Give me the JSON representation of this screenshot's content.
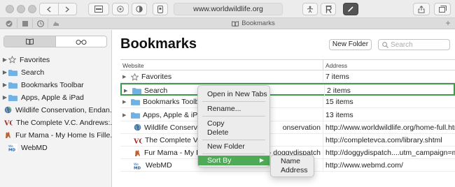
{
  "toolbar": {
    "url": "www.worldwildlife.org",
    "icons": [
      "sidebar-icon",
      "back-icon",
      "forward-icon",
      "share-ext-icon",
      "privacy-icon",
      "reader-icon",
      "extension-icon",
      "translate-icon",
      "r-icon",
      "pen-icon",
      "share-icon",
      "tabs-icon"
    ]
  },
  "tab": {
    "title": "Bookmarks"
  },
  "sidebar": {
    "items": [
      {
        "label": "Favorites",
        "icon": "star-icon"
      },
      {
        "label": "Search",
        "icon": "folder-icon"
      },
      {
        "label": "Bookmarks Toolbar",
        "icon": "folder-icon"
      },
      {
        "label": "Apps, Apple & iPad",
        "icon": "folder-icon"
      },
      {
        "label": "Wildlife Conservation, Endan...",
        "icon": "globe-icon"
      },
      {
        "label": "The Complete V.C. Andrews:...",
        "icon": "vc-icon"
      },
      {
        "label": "Fur Mama - My Home Is Fille...",
        "icon": "dog-icon"
      },
      {
        "label": "WebMD",
        "icon": "webmd-icon"
      }
    ]
  },
  "main": {
    "title": "Bookmarks",
    "new_folder": "New Folder",
    "search_placeholder": "Search",
    "col_website": "Website",
    "col_address": "Address",
    "rows": [
      {
        "name": "Favorites",
        "address": "7 items",
        "icon": "star-icon",
        "folder": true
      },
      {
        "name": "Search",
        "address": "2 items",
        "icon": "folder-icon",
        "folder": true
      },
      {
        "name": "Bookmarks Toolbar",
        "address": "15 items",
        "icon": "folder-icon",
        "folder": true
      },
      {
        "name": "Apps, Apple & iPad",
        "address": "13 items",
        "icon": "folder-icon",
        "folder": true
      },
      {
        "name": "Wildlife Conservation",
        "name_tail": "onservation",
        "address": "http://www.worldwildlife.org/home-full.html",
        "icon": "globe-icon",
        "folder": false
      },
      {
        "name": "The Complete V.C. A",
        "name_tail": "",
        "address": "http://completevca.com/library.shtml",
        "icon": "vc-icon",
        "folder": false
      },
      {
        "name": "Fur Mama - My Hom",
        "name_tail": "- doggydispatch",
        "address": "http://doggydispatch....utm_campaign=main",
        "icon": "dog-icon",
        "folder": false
      },
      {
        "name": "WebMD",
        "name_tail": "",
        "address": "http://www.webmd.com/",
        "icon": "webmd-icon",
        "folder": false
      }
    ]
  },
  "context_menu": {
    "items": [
      "Open in New Tabs",
      "Rename...",
      "Copy",
      "Delete",
      "New Folder",
      "Sort By"
    ],
    "highlighted": "Sort By",
    "submenu": [
      "Name",
      "Address"
    ]
  },
  "colors": {
    "selection": "#3c9a4a",
    "highlight": "#4faa58",
    "folder": "#6fb2e6"
  }
}
